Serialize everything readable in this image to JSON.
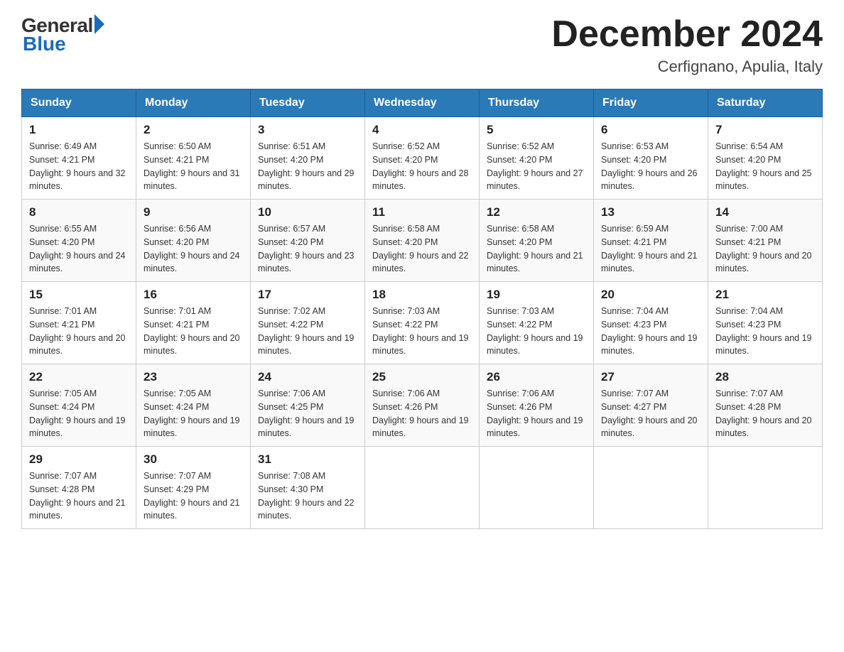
{
  "logo": {
    "general": "General",
    "blue": "Blue"
  },
  "title": "December 2024",
  "subtitle": "Cerfignano, Apulia, Italy",
  "days_of_week": [
    "Sunday",
    "Monday",
    "Tuesday",
    "Wednesday",
    "Thursday",
    "Friday",
    "Saturday"
  ],
  "weeks": [
    [
      {
        "day": "1",
        "sunrise": "6:49 AM",
        "sunset": "4:21 PM",
        "daylight": "9 hours and 32 minutes."
      },
      {
        "day": "2",
        "sunrise": "6:50 AM",
        "sunset": "4:21 PM",
        "daylight": "9 hours and 31 minutes."
      },
      {
        "day": "3",
        "sunrise": "6:51 AM",
        "sunset": "4:20 PM",
        "daylight": "9 hours and 29 minutes."
      },
      {
        "day": "4",
        "sunrise": "6:52 AM",
        "sunset": "4:20 PM",
        "daylight": "9 hours and 28 minutes."
      },
      {
        "day": "5",
        "sunrise": "6:52 AM",
        "sunset": "4:20 PM",
        "daylight": "9 hours and 27 minutes."
      },
      {
        "day": "6",
        "sunrise": "6:53 AM",
        "sunset": "4:20 PM",
        "daylight": "9 hours and 26 minutes."
      },
      {
        "day": "7",
        "sunrise": "6:54 AM",
        "sunset": "4:20 PM",
        "daylight": "9 hours and 25 minutes."
      }
    ],
    [
      {
        "day": "8",
        "sunrise": "6:55 AM",
        "sunset": "4:20 PM",
        "daylight": "9 hours and 24 minutes."
      },
      {
        "day": "9",
        "sunrise": "6:56 AM",
        "sunset": "4:20 PM",
        "daylight": "9 hours and 24 minutes."
      },
      {
        "day": "10",
        "sunrise": "6:57 AM",
        "sunset": "4:20 PM",
        "daylight": "9 hours and 23 minutes."
      },
      {
        "day": "11",
        "sunrise": "6:58 AM",
        "sunset": "4:20 PM",
        "daylight": "9 hours and 22 minutes."
      },
      {
        "day": "12",
        "sunrise": "6:58 AM",
        "sunset": "4:20 PM",
        "daylight": "9 hours and 21 minutes."
      },
      {
        "day": "13",
        "sunrise": "6:59 AM",
        "sunset": "4:21 PM",
        "daylight": "9 hours and 21 minutes."
      },
      {
        "day": "14",
        "sunrise": "7:00 AM",
        "sunset": "4:21 PM",
        "daylight": "9 hours and 20 minutes."
      }
    ],
    [
      {
        "day": "15",
        "sunrise": "7:01 AM",
        "sunset": "4:21 PM",
        "daylight": "9 hours and 20 minutes."
      },
      {
        "day": "16",
        "sunrise": "7:01 AM",
        "sunset": "4:21 PM",
        "daylight": "9 hours and 20 minutes."
      },
      {
        "day": "17",
        "sunrise": "7:02 AM",
        "sunset": "4:22 PM",
        "daylight": "9 hours and 19 minutes."
      },
      {
        "day": "18",
        "sunrise": "7:03 AM",
        "sunset": "4:22 PM",
        "daylight": "9 hours and 19 minutes."
      },
      {
        "day": "19",
        "sunrise": "7:03 AM",
        "sunset": "4:22 PM",
        "daylight": "9 hours and 19 minutes."
      },
      {
        "day": "20",
        "sunrise": "7:04 AM",
        "sunset": "4:23 PM",
        "daylight": "9 hours and 19 minutes."
      },
      {
        "day": "21",
        "sunrise": "7:04 AM",
        "sunset": "4:23 PM",
        "daylight": "9 hours and 19 minutes."
      }
    ],
    [
      {
        "day": "22",
        "sunrise": "7:05 AM",
        "sunset": "4:24 PM",
        "daylight": "9 hours and 19 minutes."
      },
      {
        "day": "23",
        "sunrise": "7:05 AM",
        "sunset": "4:24 PM",
        "daylight": "9 hours and 19 minutes."
      },
      {
        "day": "24",
        "sunrise": "7:06 AM",
        "sunset": "4:25 PM",
        "daylight": "9 hours and 19 minutes."
      },
      {
        "day": "25",
        "sunrise": "7:06 AM",
        "sunset": "4:26 PM",
        "daylight": "9 hours and 19 minutes."
      },
      {
        "day": "26",
        "sunrise": "7:06 AM",
        "sunset": "4:26 PM",
        "daylight": "9 hours and 19 minutes."
      },
      {
        "day": "27",
        "sunrise": "7:07 AM",
        "sunset": "4:27 PM",
        "daylight": "9 hours and 20 minutes."
      },
      {
        "day": "28",
        "sunrise": "7:07 AM",
        "sunset": "4:28 PM",
        "daylight": "9 hours and 20 minutes."
      }
    ],
    [
      {
        "day": "29",
        "sunrise": "7:07 AM",
        "sunset": "4:28 PM",
        "daylight": "9 hours and 21 minutes."
      },
      {
        "day": "30",
        "sunrise": "7:07 AM",
        "sunset": "4:29 PM",
        "daylight": "9 hours and 21 minutes."
      },
      {
        "day": "31",
        "sunrise": "7:08 AM",
        "sunset": "4:30 PM",
        "daylight": "9 hours and 22 minutes."
      },
      null,
      null,
      null,
      null
    ]
  ]
}
